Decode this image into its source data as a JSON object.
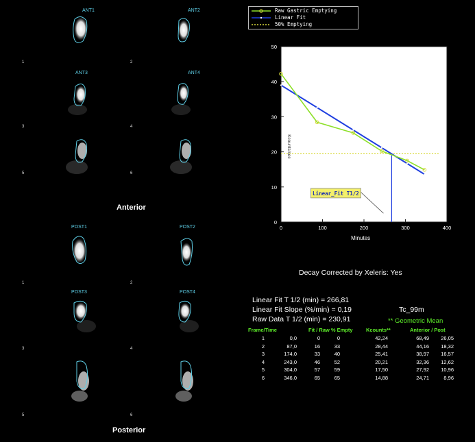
{
  "anterior": {
    "title": "Anterior",
    "frames": [
      {
        "label": "ANT1",
        "num": "1"
      },
      {
        "label": "ANT2",
        "num": "2"
      },
      {
        "label": "ANT3",
        "num": "3"
      },
      {
        "label": "ANT4",
        "num": "4"
      },
      {
        "label": "",
        "num": "5"
      },
      {
        "label": "",
        "num": "6"
      }
    ]
  },
  "posterior": {
    "title": "Posterior",
    "frames": [
      {
        "label": "POST1",
        "num": "1"
      },
      {
        "label": "POST2",
        "num": "2"
      },
      {
        "label": "POST3",
        "num": "3"
      },
      {
        "label": "POST4",
        "num": "4"
      },
      {
        "label": "",
        "num": "5"
      },
      {
        "label": "",
        "num": "6"
      }
    ]
  },
  "legend": {
    "raw": "Raw Gastric Emptying",
    "linear": "Linear Fit",
    "half": "50% Emptying"
  },
  "colors": {
    "raw": "#8ee02a",
    "linear": "#1f3fe0",
    "half": "#d8d83a",
    "roi": "#5fd0e8",
    "header_green": "#5ef02a"
  },
  "chart_data": {
    "type": "line",
    "xlabel": "Minutes",
    "ylabel": "Kcounts/sec",
    "xlim": [
      0,
      400
    ],
    "ylim": [
      0,
      50
    ],
    "xticks": [
      0,
      100,
      200,
      300,
      400
    ],
    "yticks": [
      0,
      10,
      20,
      30,
      40,
      50
    ],
    "grid": false,
    "legend_position": "above",
    "series": [
      {
        "name": "Raw Gastric Emptying",
        "x": [
          0,
          87,
          174,
          243,
          304,
          346
        ],
        "y": [
          42.24,
          28.44,
          25.41,
          20.21,
          17.5,
          14.88
        ]
      },
      {
        "name": "Linear Fit",
        "x": [
          0,
          346
        ],
        "y": [
          39,
          13.6
        ]
      },
      {
        "name": "50% Emptying",
        "x": [
          0,
          380
        ],
        "y": [
          19.5,
          19.5
        ]
      }
    ],
    "half_time": 266.81,
    "annotation": "Linear_Fit T1/2"
  },
  "decay": "Decay Corrected by Xeleris: Yes",
  "stats": {
    "fit_half": "Linear Fit T 1/2 (min) = 266,81",
    "slope": "Linear Fit Slope (%/min) = 0,19",
    "raw_half": "Raw Data T 1/2 (min) = 230,91",
    "isotope": "Tc_99m",
    "geo_mean": "** Geometric Mean"
  },
  "table": {
    "headers": [
      "Frame/Time",
      "Fit / Raw % Empty",
      "Kcounts**",
      "Anterior / Post"
    ],
    "rows": [
      [
        "1",
        "0,0",
        "0",
        "0",
        "42,24",
        "68,49",
        "26,05"
      ],
      [
        "2",
        "87,0",
        "16",
        "33",
        "28,44",
        "44,16",
        "18,32"
      ],
      [
        "3",
        "174,0",
        "33",
        "40",
        "25,41",
        "38,97",
        "16,57"
      ],
      [
        "4",
        "243,0",
        "46",
        "52",
        "20,21",
        "32,36",
        "12,62"
      ],
      [
        "5",
        "304,0",
        "57",
        "59",
        "17,50",
        "27,92",
        "10,96"
      ],
      [
        "6",
        "346,0",
        "65",
        "65",
        "14,88",
        "24,71",
        "8,96"
      ]
    ]
  }
}
